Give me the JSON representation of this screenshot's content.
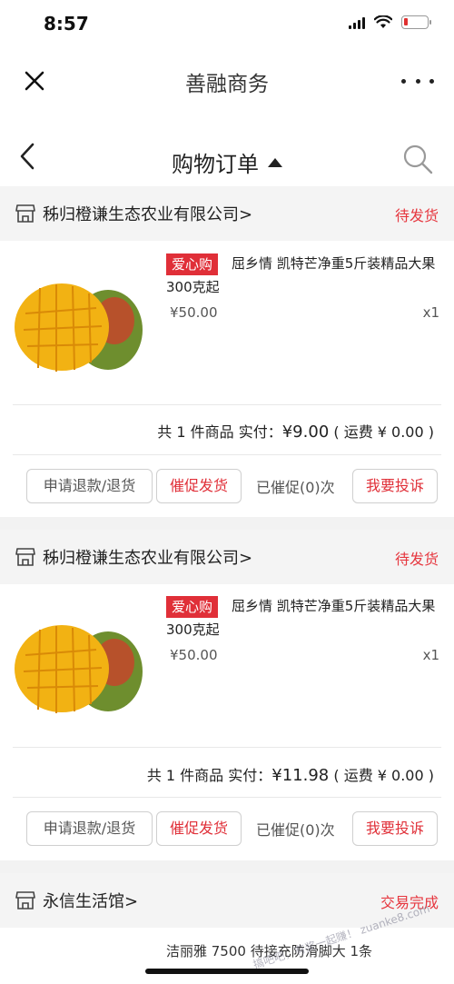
{
  "status_bar": {
    "time": "8:57"
  },
  "app": {
    "title": "善融商务"
  },
  "nav": {
    "title": "购物订单"
  },
  "orders": [
    {
      "shop": "秭归橙谦生态农业有限公司>",
      "status": "待发货",
      "tag": "爱心购",
      "product_title": "屈乡情 凯特芒净重5斤装精品大果 300克起",
      "price": "¥50.00",
      "qty": "x1",
      "summary_prefix": "共 1 件商品  实付：",
      "paid": "¥9.00",
      "summary_suffix": "( 运费 ¥ 0.00 )",
      "btn_refund": "申请退款/退货",
      "btn_urge": "催促发货",
      "urged": "已催促(0)次",
      "btn_complain": "我要投诉"
    },
    {
      "shop": "秭归橙谦生态农业有限公司>",
      "status": "待发货",
      "tag": "爱心购",
      "product_title": "屈乡情 凯特芒净重5斤装精品大果 300克起",
      "price": "¥50.00",
      "qty": "x1",
      "summary_prefix": "共 1 件商品  实付：",
      "paid": "¥11.98",
      "summary_suffix": "( 运费 ¥ 0.00 )",
      "btn_refund": "申请退款/退货",
      "btn_urge": "催促发货",
      "urged": "已催促(0)次",
      "btn_complain": "我要投诉"
    },
    {
      "shop": "永信生活馆>",
      "status": "交易完成",
      "product_title_partial": "洁丽雅 7500 待接充防滑脚大 1条"
    }
  ],
  "watermark": "搞吧吧，有奖一起赚！ zuanke8.com",
  "colors": {
    "accent_red": "#e02f38",
    "status_red": "#e6373f"
  },
  "icons": [
    "close-icon",
    "more-icon",
    "back-icon",
    "caret-up-icon",
    "search-icon",
    "shop-icon",
    "mango-image"
  ]
}
